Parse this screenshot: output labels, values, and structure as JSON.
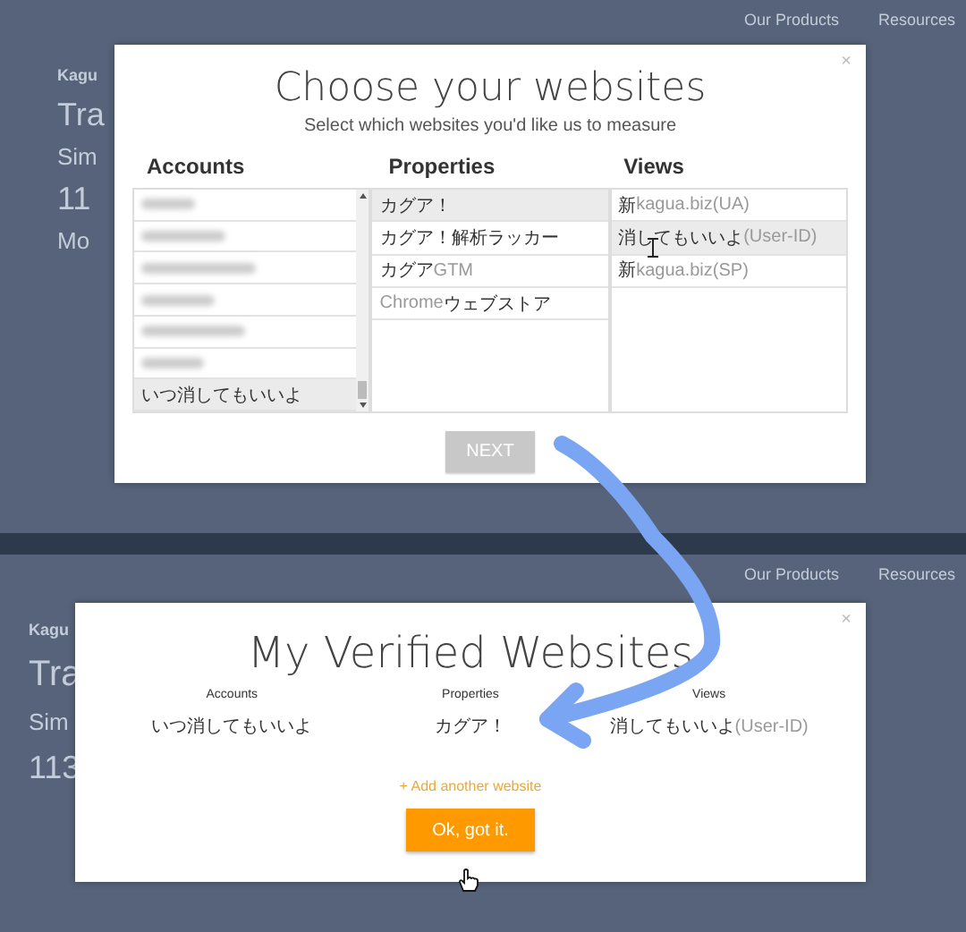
{
  "top_panel": {
    "background": {
      "nav": [
        "Our Products",
        "Resources"
      ],
      "left_texts": [
        {
          "kind": "label",
          "text": "Kagu"
        },
        {
          "kind": "heading",
          "text": "Tra"
        },
        {
          "kind": "sub",
          "text": "Sim"
        },
        {
          "kind": "number",
          "text": "11"
        },
        {
          "kind": "sub",
          "text": "Mo"
        }
      ]
    },
    "dialog": {
      "close": "×",
      "title": "Choose your websites",
      "subtitle": "Select which websites you'd like us to measure",
      "columns": [
        {
          "heading": "Accounts",
          "scrollbar": true,
          "items": [
            {
              "kind": "redacted",
              "selected": false
            },
            {
              "kind": "redacted",
              "selected": false
            },
            {
              "kind": "redacted",
              "selected": false
            },
            {
              "kind": "redacted",
              "selected": false
            },
            {
              "kind": "redacted",
              "selected": false
            },
            {
              "kind": "redacted",
              "selected": false
            },
            {
              "kind": "text",
              "selected": true,
              "parts": [
                {
                  "text": "いつ消してもいいよ",
                  "muted": false
                }
              ]
            }
          ]
        },
        {
          "heading": "Properties",
          "scrollbar": false,
          "items": [
            {
              "kind": "text",
              "selected": true,
              "parts": [
                {
                  "text": "カグア！",
                  "muted": false
                }
              ]
            },
            {
              "kind": "text",
              "selected": false,
              "parts": [
                {
                  "text": "カグア！解析ラッカー",
                  "muted": false
                }
              ]
            },
            {
              "kind": "text",
              "selected": false,
              "parts": [
                {
                  "text": "カグア",
                  "muted": false
                },
                {
                  "text": "GTM",
                  "muted": true
                }
              ]
            },
            {
              "kind": "text",
              "selected": false,
              "parts": [
                {
                  "text": "Chrome",
                  "muted": true
                },
                {
                  "text": "ウェブストア",
                  "muted": false
                }
              ]
            }
          ]
        },
        {
          "heading": "Views",
          "scrollbar": false,
          "items": [
            {
              "kind": "text",
              "selected": false,
              "parts": [
                {
                  "text": "新",
                  "muted": false
                },
                {
                  "text": "kagua.biz(UA)",
                  "muted": true
                }
              ]
            },
            {
              "kind": "text",
              "selected": true,
              "parts": [
                {
                  "text": "消してもいいよ",
                  "muted": false
                },
                {
                  "text": "(User-ID)",
                  "muted": true
                }
              ]
            },
            {
              "kind": "text",
              "selected": false,
              "parts": [
                {
                  "text": "新",
                  "muted": false
                },
                {
                  "text": "kagua.biz(SP)",
                  "muted": true
                }
              ]
            }
          ]
        }
      ],
      "next_button": {
        "label": "NEXT",
        "disabled": true
      }
    }
  },
  "bottom_panel": {
    "background": {
      "nav": [
        "Our Products",
        "Resources"
      ],
      "left_texts": [
        {
          "kind": "label",
          "text": "Kagu"
        },
        {
          "kind": "heading",
          "text": "Tra"
        },
        {
          "kind": "sub",
          "text": "Sim"
        },
        {
          "kind": "number",
          "text": "113"
        }
      ]
    },
    "dialog": {
      "close": "×",
      "title": "My Verified Websites",
      "columns": [
        {
          "heading": "Accounts",
          "parts": [
            {
              "text": "いつ消してもいいよ",
              "muted": false
            }
          ]
        },
        {
          "heading": "Properties",
          "parts": [
            {
              "text": "カグア！",
              "muted": false
            }
          ]
        },
        {
          "heading": "Views",
          "parts": [
            {
              "text": "消してもいいよ",
              "muted": false
            },
            {
              "text": "(User-ID)",
              "muted": true
            }
          ]
        }
      ],
      "add_link": "+ Add another website",
      "ok_button": "Ok, got it."
    }
  }
}
